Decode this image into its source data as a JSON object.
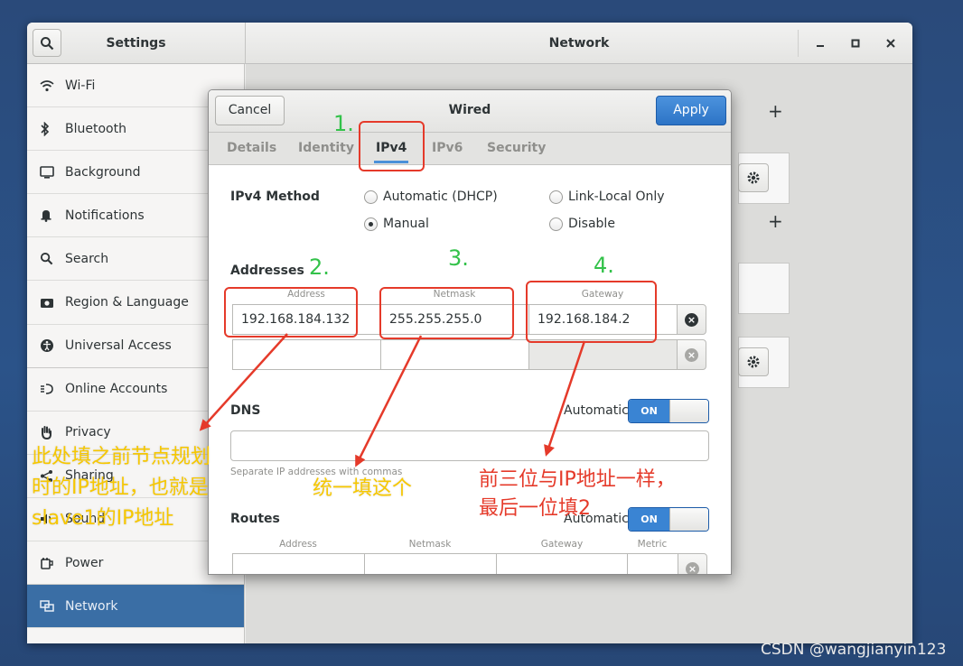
{
  "window": {
    "app_title": "Settings",
    "panel_title": "Network"
  },
  "sidebar": {
    "items": [
      {
        "label": "Wi-Fi",
        "icon": "wifi-icon"
      },
      {
        "label": "Bluetooth",
        "icon": "bluetooth-icon"
      },
      {
        "label": "Background",
        "icon": "background-icon"
      },
      {
        "label": "Notifications",
        "icon": "bell-icon"
      },
      {
        "label": "Search",
        "icon": "search-icon"
      },
      {
        "label": "Region & Language",
        "icon": "camera-icon"
      },
      {
        "label": "Universal Access",
        "icon": "universal-access-icon"
      },
      {
        "label": "Online Accounts",
        "icon": "online-accounts-icon"
      },
      {
        "label": "Privacy",
        "icon": "hand-icon"
      },
      {
        "label": "Sharing",
        "icon": "share-icon"
      },
      {
        "label": "Sound",
        "icon": "speaker-icon"
      },
      {
        "label": "Power",
        "icon": "power-icon"
      },
      {
        "label": "Network",
        "icon": "network-icon",
        "active": true
      }
    ]
  },
  "dialog": {
    "title": "Wired",
    "cancel_label": "Cancel",
    "apply_label": "Apply",
    "tabs": [
      "Details",
      "Identity",
      "IPv4",
      "IPv6",
      "Security"
    ],
    "active_tab": "IPv4",
    "ipv4_method_label": "IPv4 Method",
    "methods": {
      "automatic": "Automatic (DHCP)",
      "manual": "Manual",
      "link_local": "Link-Local Only",
      "disable": "Disable"
    },
    "selected_method": "Manual",
    "addresses_label": "Addresses",
    "address_columns": {
      "address": "Address",
      "netmask": "Netmask",
      "gateway": "Gateway"
    },
    "address_rows": [
      {
        "address": "192.168.184.132",
        "netmask": "255.255.255.0",
        "gateway": "192.168.184.2"
      },
      {
        "address": "",
        "netmask": "",
        "gateway": ""
      }
    ],
    "dns_label": "DNS",
    "dns_automatic_label": "Automatic",
    "dns_switch": "ON",
    "dns_value": "",
    "dns_hint": "Separate IP addresses with commas",
    "routes_label": "Routes",
    "routes_automatic_label": "Automatic",
    "routes_switch": "ON",
    "route_columns": {
      "address": "Address",
      "netmask": "Netmask",
      "gateway": "Gateway",
      "metric": "Metric"
    }
  },
  "annotations": {
    "step1": "1.",
    "step2": "2.",
    "step3": "3.",
    "step4": "4.",
    "note_address": [
      "此处填之前节点规划",
      "时的IP地址，也就是",
      "slave1的IP地址"
    ],
    "note_netmask": "统一填这个",
    "note_gateway": [
      "前三位与IP地址一样，",
      "最后一位填2"
    ]
  },
  "watermark": "CSDN @wangjianyin123",
  "colors": {
    "accent": "#3a6ea5",
    "apply": "#2d74c6",
    "annotation_red": "#e53a2a",
    "annotation_green": "#33c24a",
    "annotation_yellow": "#f6c700"
  }
}
